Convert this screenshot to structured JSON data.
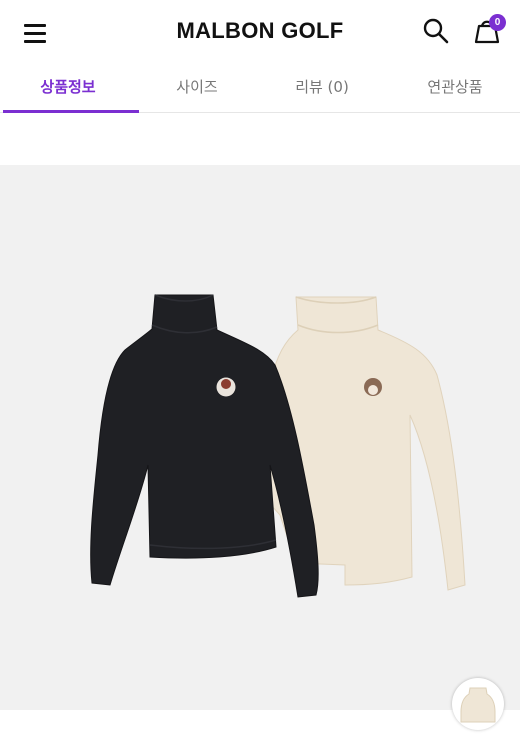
{
  "header": {
    "brand": "MALBON GOLF",
    "menu_icon": "hamburger-menu-icon",
    "search_icon": "search-icon",
    "cart_icon": "shopping-bag-icon",
    "cart_count": "0"
  },
  "tabs": [
    {
      "label": "상품정보",
      "active": true
    },
    {
      "label": "사이즈",
      "active": false
    },
    {
      "label": "리뷰 (0)",
      "active": false
    },
    {
      "label": "연관상품",
      "active": false
    }
  ],
  "product": {
    "items": [
      "black-turtleneck-sweater",
      "cream-turtleneck-sweater"
    ]
  },
  "colors": {
    "accent": "#7b2fd1",
    "product_background": "#f1f1f1",
    "sweater_black": "#1f2024",
    "sweater_cream": "#efe6d6"
  }
}
